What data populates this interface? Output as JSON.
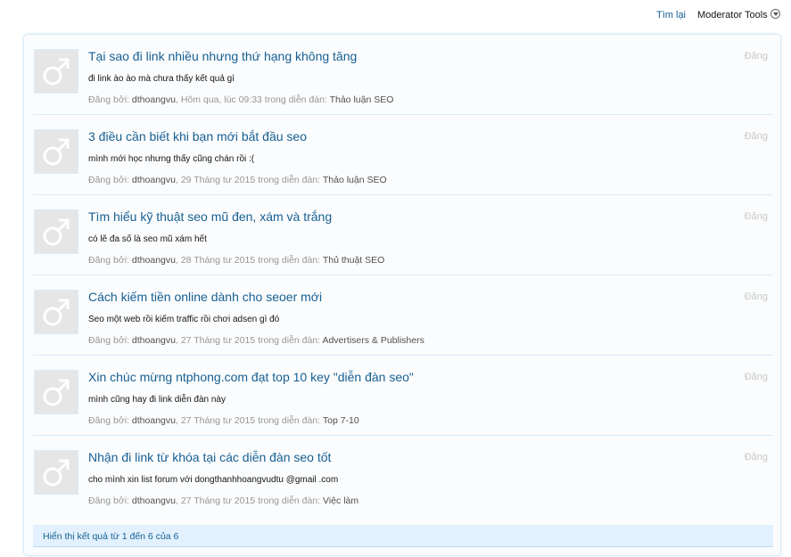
{
  "topbar": {
    "search_link": "Tìm lại",
    "moderator_tools": "Moderator Tools"
  },
  "results": [
    {
      "title": "Tại sao đi link nhiều nhưng thứ hạng không tăng",
      "snippet": "đi link ào ào mà chưa thấy kết quả gì",
      "posted_by_label": "Đăng bởi:",
      "user": "dthoangvu",
      "date": "Hôm qua, lúc 09:33",
      "in_forum_label": "trong diễn đàn:",
      "forum": "Thảo luận SEO",
      "type_label": "Đăng"
    },
    {
      "title": "3 điều cần biết khi bạn mới bắt đầu seo",
      "snippet": "mình mới học nhưng thấy cũng chán rồi :(",
      "posted_by_label": "Đăng bởi:",
      "user": "dthoangvu",
      "date": "29 Tháng tư 2015",
      "in_forum_label": "trong diễn đàn:",
      "forum": "Thảo luận SEO",
      "type_label": "Đăng"
    },
    {
      "title": "Tìm hiểu kỹ thuật seo mũ đen, xám và trắng",
      "snippet": "có lẽ đa số là seo mũ xám hết",
      "posted_by_label": "Đăng bởi:",
      "user": "dthoangvu",
      "date": "28 Tháng tư 2015",
      "in_forum_label": "trong diễn đàn:",
      "forum": "Thủ thuật SEO",
      "type_label": "Đăng"
    },
    {
      "title": "Cách kiếm tiền online dành cho seoer mới",
      "snippet": "Seo một web rồi kiếm traffic rồi chơi adsen gì đó",
      "posted_by_label": "Đăng bởi:",
      "user": "dthoangvu",
      "date": "27 Tháng tư 2015",
      "in_forum_label": "trong diễn đàn:",
      "forum": "Advertisers & Publishers",
      "type_label": "Đăng"
    },
    {
      "title": "Xin chúc mừng ntphong.com đạt top 10 key \"diễn đàn seo\"",
      "snippet": "mình cũng hay đi link diễn đàn này",
      "posted_by_label": "Đăng bởi:",
      "user": "dthoangvu",
      "date": "27 Tháng tư 2015",
      "in_forum_label": "trong diễn đàn:",
      "forum": "Top 7-10",
      "type_label": "Đăng"
    },
    {
      "title": "Nhận đi link từ khóa tại các diễn đàn seo tốt",
      "snippet": "cho mình xin list forum với dongthanhhoangvudtu @gmail .com",
      "posted_by_label": "Đăng bởi:",
      "user": "dthoangvu",
      "date": "27 Tháng tư 2015",
      "in_forum_label": "trong diễn đàn:",
      "forum": "Việc làm",
      "type_label": "Đăng"
    }
  ],
  "footer": {
    "summary": "Hiển thị kết quả từ 1 đến 6 của 6"
  },
  "icons": {
    "avatar": "male-avatar-icon",
    "moderator_dropdown": "chevron-down-icon"
  },
  "colors": {
    "link": "#176093",
    "muted": "#969696",
    "border": "#d7edfc",
    "footer_bg": "#e2f1fd"
  }
}
